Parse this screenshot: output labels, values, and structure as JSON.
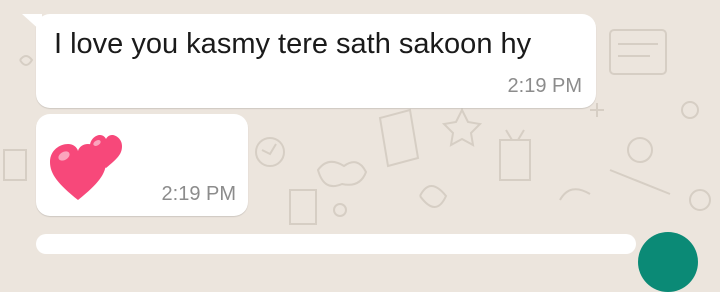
{
  "messages": [
    {
      "text": "I love you kasmy tere sath sakoon hy",
      "time": "2:19 PM"
    },
    {
      "emoji": "two-hearts",
      "time": "2:19 PM"
    }
  ],
  "colors": {
    "wallpaper": "#ece5dd",
    "bubble": "#ffffff",
    "heart": "#f7487a",
    "timestamp": "#8c8c8c",
    "fab": "#0b8a76"
  }
}
